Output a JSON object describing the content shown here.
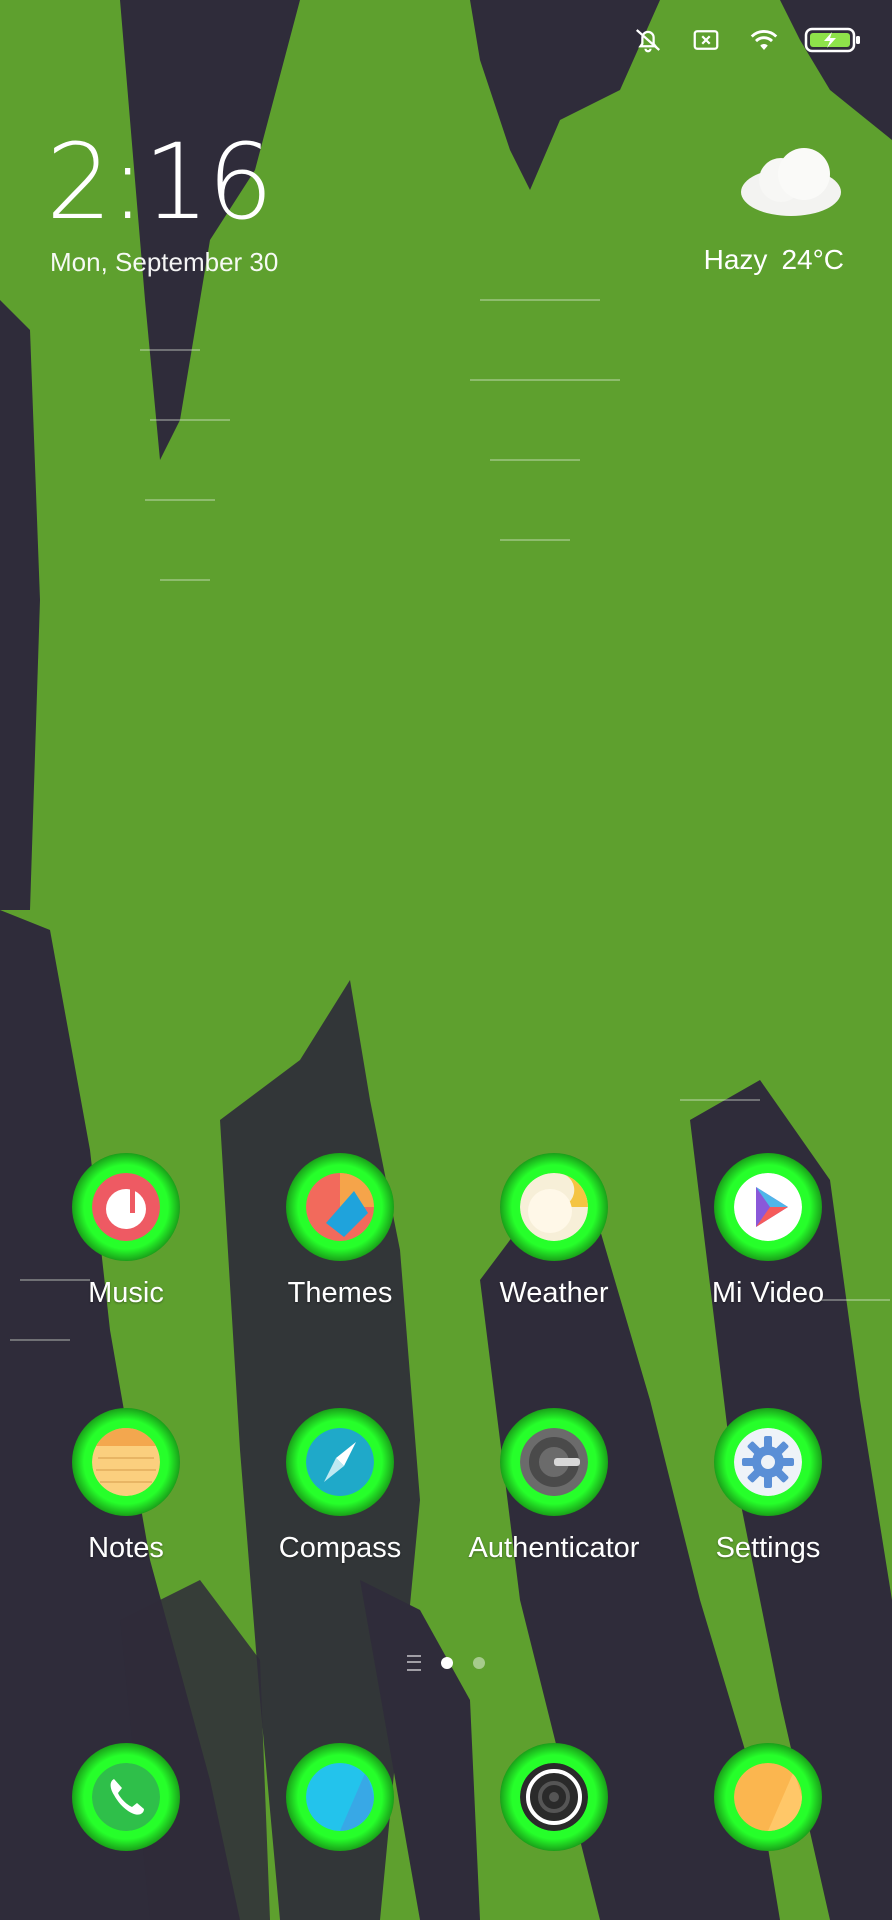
{
  "status_bar": {
    "icons": [
      "silent-bell-icon",
      "no-sim-icon",
      "wifi-icon",
      "battery-charging-icon"
    ]
  },
  "clock": {
    "time": "2:16",
    "date": "Mon, September 30"
  },
  "weather": {
    "condition": "Hazy",
    "temperature": "24°C",
    "icon": "cloud-icon"
  },
  "apps": [
    {
      "label": "Music",
      "icon": "music-icon"
    },
    {
      "label": "Themes",
      "icon": "themes-icon"
    },
    {
      "label": "Weather",
      "icon": "weather-app-icon"
    },
    {
      "label": "Mi Video",
      "icon": "mi-video-icon"
    },
    {
      "label": "Notes",
      "icon": "notes-icon"
    },
    {
      "label": "Compass",
      "icon": "compass-icon"
    },
    {
      "label": "Authenticator",
      "icon": "authenticator-icon"
    },
    {
      "label": "Settings",
      "icon": "settings-icon"
    }
  ],
  "pager": {
    "page_count": 2,
    "active_page": 1
  },
  "dock": [
    {
      "icon": "phone-icon"
    },
    {
      "icon": "browser-icon"
    },
    {
      "icon": "camera-icon"
    },
    {
      "icon": "messaging-icon"
    }
  ],
  "colors": {
    "wallpaper_green": "#5a9b2e",
    "wallpaper_dark": "#2f2c3a",
    "icon_glow": "#26ff2a"
  }
}
